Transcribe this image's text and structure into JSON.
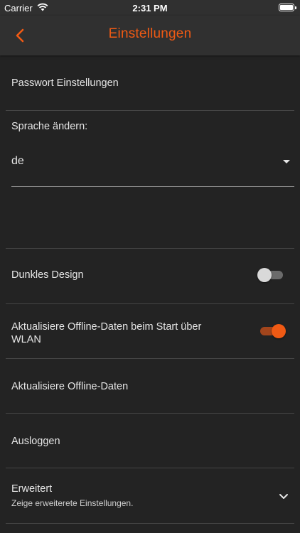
{
  "status_bar": {
    "carrier": "Carrier",
    "time": "2:31 PM",
    "wifi_icon": "wifi-icon",
    "battery_icon": "battery-icon"
  },
  "header": {
    "title": "Einstellungen",
    "back_icon": "chevron-left-icon"
  },
  "colors": {
    "accent": "#f05a14",
    "background": "#232323",
    "bar": "#303030",
    "divider": "#454545"
  },
  "settings": {
    "password": {
      "label": "Passwort Einstellungen"
    },
    "language": {
      "label": "Sprache ändern:",
      "value": "de"
    },
    "dark_design": {
      "label": "Dunkles Design",
      "enabled": false
    },
    "offline_on_start": {
      "label": "Aktualisiere Offline-Daten beim Start über WLAN",
      "enabled": true
    },
    "update_offline": {
      "label": "Aktualisiere Offline-Daten"
    },
    "logout": {
      "label": "Ausloggen"
    },
    "advanced": {
      "label": "Erweitert",
      "sublabel": "Zeige erweiterete Einstellungen.",
      "icon": "chevron-down-icon"
    }
  }
}
